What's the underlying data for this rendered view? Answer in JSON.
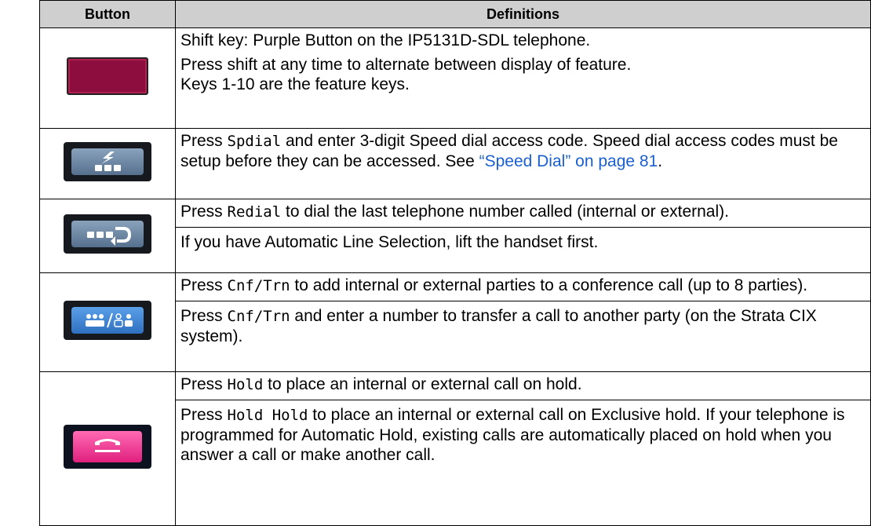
{
  "table": {
    "headers": {
      "button": "Button",
      "definitions": "Definitions"
    },
    "rows": [
      {
        "icon": "shift-key-purple-icon",
        "p1": "Shift key: Purple Button on the IP5131D-SDL telephone.",
        "p2": "Press shift at any time to alternate between display of feature.",
        "p3": "Keys 1-10 are the feature keys."
      },
      {
        "icon": "speed-dial-icon",
        "a1": "Press ",
        "key": "Spdial",
        "a2": " and enter 3-digit Speed dial access code. Speed dial access codes must be setup before they can be accessed. See ",
        "link": "“Speed Dial” on page 81",
        "a3": "."
      },
      {
        "icon": "redial-icon",
        "a1": "Press ",
        "key": "Redial",
        "a2": " to dial the last telephone number called (internal or external).",
        "p2": "If you have Automatic Line Selection, lift the handset first."
      },
      {
        "icon": "conference-transfer-icon",
        "a1": "Press ",
        "key": "Cnf/Trn",
        "a2": " to add internal or external parties to a conference call (up to 8 parties).",
        "b1": "Press ",
        "key2": "Cnf/Trn",
        "b2": " and enter a number to transfer a call to another party (on the Strata CIX system)."
      },
      {
        "icon": "hold-icon",
        "a1": "Press ",
        "key": "Hold",
        "a2": " to place an internal or external call on hold.",
        "b1": "Press ",
        "key2": "Hold Hold",
        "b2": " to place an internal or external call on Exclusive hold. If your telephone is programmed for Automatic Hold, existing calls are automatically placed on hold when you answer a call or make another call."
      }
    ]
  },
  "colors": {
    "header_bg": "#cfcfcf",
    "link": "#1a5fd0",
    "shift": "#8c0d3e",
    "hold": "#ff4aa0"
  }
}
